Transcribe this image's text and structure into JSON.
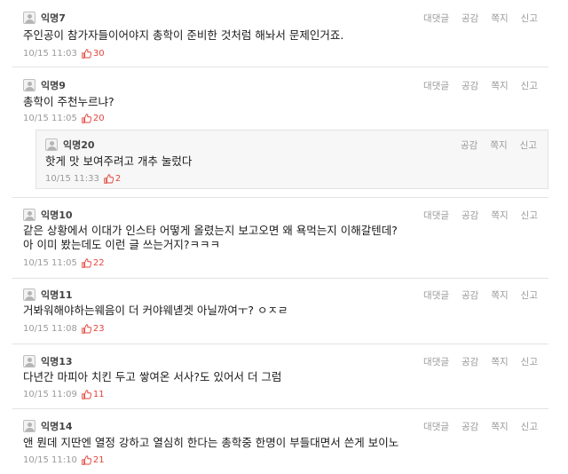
{
  "actions": {
    "reply": "대댓글",
    "like": "공감",
    "message": "쪽지",
    "report": "신고"
  },
  "comments": [
    {
      "author": "익명7",
      "lines": [
        "주인공이 참가자들이어야지 총학이 준비한 것처럼 해놔서 문제인거죠."
      ],
      "time": "10/15 11:03",
      "likes": "30"
    },
    {
      "author": "익명9",
      "lines": [
        "총학이 주천누르냐?"
      ],
      "time": "10/15 11:05",
      "likes": "20"
    },
    {
      "author": "익명20",
      "lines": [
        "핫게 맛 보여주려고 개추 눌렀다"
      ],
      "time": "10/15 11:33",
      "likes": "2"
    },
    {
      "author": "익명10",
      "lines": [
        "같은 상황에서 이대가 인스타 어떻게 올렸는지 보고오면 왜 욕먹는지 이해갈텐데?",
        "아 이미 봤는데도 이런 글 쓰는거지?ㅋㅋㅋ"
      ],
      "time": "10/15 11:05",
      "likes": "22"
    },
    {
      "author": "익명11",
      "lines": [
        "거봐워해야하는웨음이 더 커야웨녣겟 아닐까여ㅜ? ㅇㅈㄹ"
      ],
      "time": "10/15 11:08",
      "likes": "23"
    },
    {
      "author": "익명13",
      "lines": [
        "다년간 마피아 치킨 두고 쌓여온 서사?도 있어서 더 그럼"
      ],
      "time": "10/15 11:09",
      "likes": "11"
    },
    {
      "author": "익명14",
      "lines": [
        "앤 뭔데 지딴엔 열정 강하고 열심히 한다는 총학중 한명이 부들대면서 쓴게 보이노"
      ],
      "time": "10/15 11:10",
      "likes": "21"
    }
  ]
}
